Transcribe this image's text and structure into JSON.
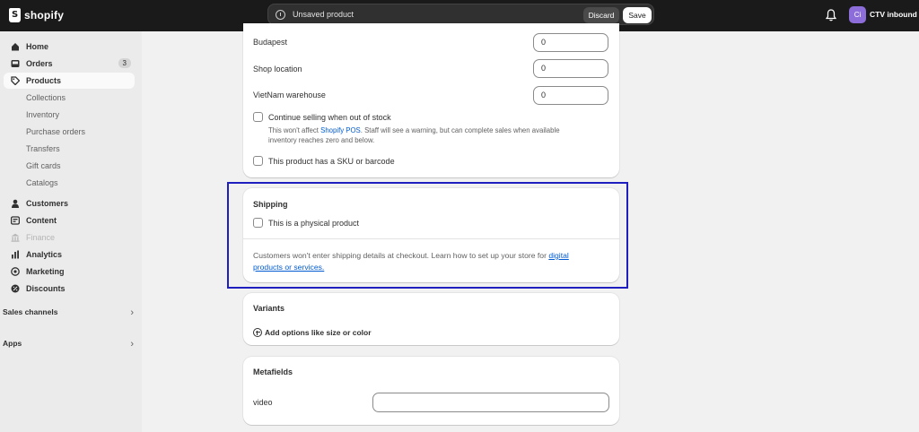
{
  "topbar": {
    "logo_text": "shopify",
    "unsaved_text": "Unsaved product",
    "discard_label": "Discard",
    "save_label": "Save",
    "avatar_initials": "Ci",
    "store_name": "CTV inbound"
  },
  "sidebar": {
    "items": [
      {
        "label": "Home",
        "icon": "home-icon"
      },
      {
        "label": "Orders",
        "icon": "inbox-icon",
        "badge": "3"
      },
      {
        "label": "Products",
        "icon": "tag-icon",
        "active": true
      },
      {
        "label": "Collections"
      },
      {
        "label": "Inventory"
      },
      {
        "label": "Purchase orders"
      },
      {
        "label": "Transfers"
      },
      {
        "label": "Gift cards"
      },
      {
        "label": "Catalogs"
      },
      {
        "label": "Customers",
        "icon": "person-icon"
      },
      {
        "label": "Content",
        "icon": "content-icon"
      },
      {
        "label": "Finance",
        "icon": "bank-icon",
        "disabled": true
      },
      {
        "label": "Analytics",
        "icon": "chart-icon"
      },
      {
        "label": "Marketing",
        "icon": "target-icon"
      },
      {
        "label": "Discounts",
        "icon": "discount-icon"
      }
    ],
    "sales_channels": "Sales channels",
    "apps": "Apps"
  },
  "inventory": {
    "locations": [
      {
        "name": "Budapest",
        "quantity": "0"
      },
      {
        "name": "Shop location",
        "quantity": "0"
      },
      {
        "name": "VietNam warehouse",
        "quantity": "0"
      }
    ],
    "continue_selling_label": "Continue selling when out of stock",
    "continue_selling_help_1": "This won't affect",
    "continue_selling_help_link": "Shopify POS",
    "continue_selling_help_2": ". Staff will see a warning, but can complete sales when available",
    "continue_selling_help_3": "inventory reaches zero and below.",
    "sku_label": "This product has a SKU or barcode"
  },
  "shipping": {
    "title": "Shipping",
    "physical_label": "This is a physical product",
    "info_text": "Customers won't enter shipping details at checkout. Learn how to set up your store for",
    "info_link_1": "digital",
    "info_link_2": "products or services."
  },
  "variants": {
    "title": "Variants",
    "add_options_label": "Add options like size or color"
  },
  "metafields": {
    "title": "Metafields",
    "field_label": "video",
    "field_value": ""
  }
}
